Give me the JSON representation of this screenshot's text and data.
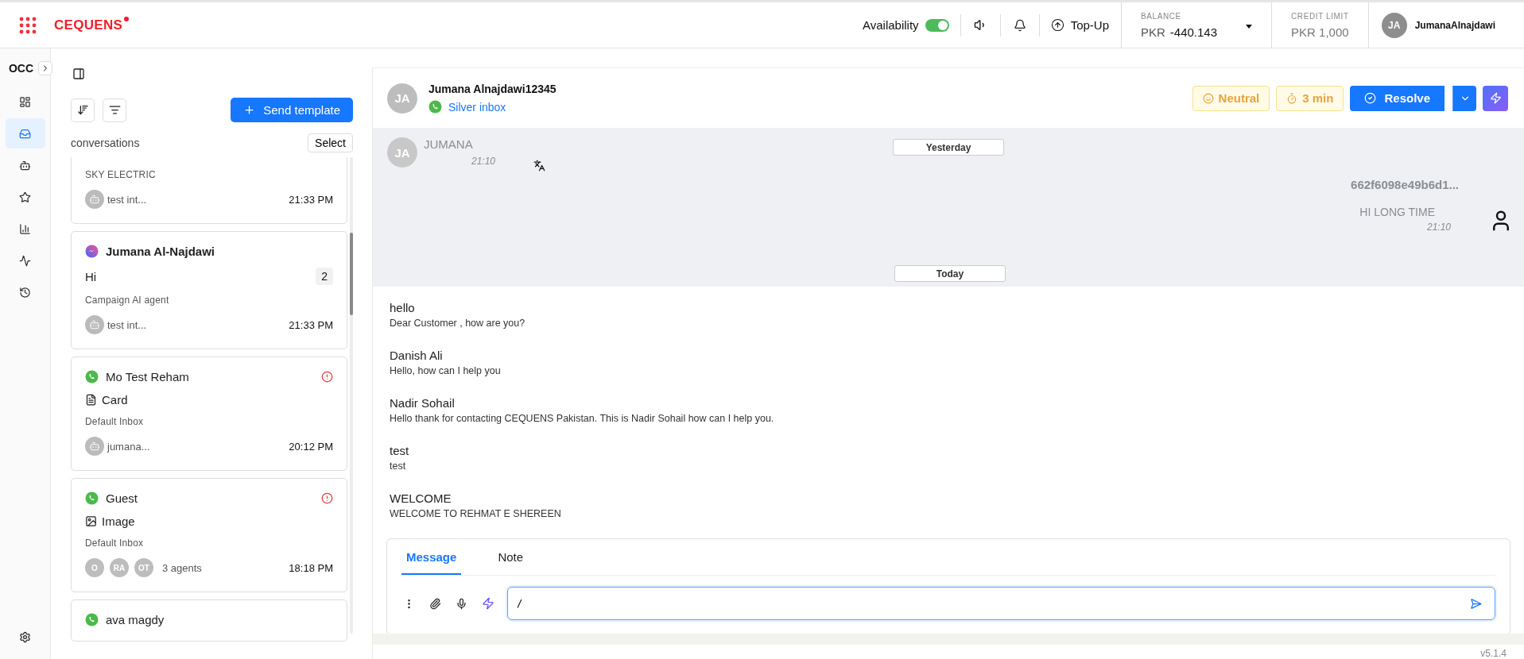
{
  "brand": {
    "name": "CEQUENS"
  },
  "topbar": {
    "availability": {
      "label": "Availability",
      "on": true
    },
    "topup": "Top-Up",
    "balance": {
      "label": "BALANCE",
      "currency": "PKR",
      "amount": "-440.143"
    },
    "credit_limit": {
      "label": "CREDIT LIMIT",
      "value": "PKR 1,000"
    },
    "user": {
      "initials": "JA",
      "name": "JumanaAlnajdawi"
    }
  },
  "nav": {
    "title": "OCC",
    "items": [
      {
        "selected": false
      },
      {
        "selected": true
      },
      {
        "selected": false
      },
      {
        "selected": false
      },
      {
        "selected": false
      },
      {
        "selected": false
      },
      {
        "selected": false
      }
    ]
  },
  "conversations": {
    "send_template": "Send template",
    "heading": "conversations",
    "select": "Select",
    "items": [
      {
        "inbox": "SKY ELECTRIC",
        "agent": "test int...",
        "time": "21:33 PM",
        "alert": false
      },
      {
        "channel": {
          "kind": "messenger"
        },
        "name": "Jumana Al-Najdawi",
        "bold": true,
        "preview": {
          "text": "Hi"
        },
        "unread": "2",
        "inbox": "Campaign AI agent",
        "agent": "test int...",
        "time": "21:33 PM",
        "alert": false
      },
      {
        "channel": {
          "kind": "whatsapp"
        },
        "name": "Mo Test Reham",
        "preview": {
          "text": "Card",
          "kind": "card"
        },
        "inbox": "Default Inbox",
        "agent": "jumana...",
        "time": "20:12 PM",
        "alert": true
      },
      {
        "channel": {
          "kind": "whatsapp"
        },
        "name": "Guest",
        "preview": {
          "text": "Image",
          "kind": "image"
        },
        "inbox": "Default Inbox",
        "assignees": [
          "O",
          "RA",
          "OT"
        ],
        "agents_label": "3 agents",
        "time": "18:18 PM",
        "alert": true
      },
      {
        "channel": {
          "kind": "whatsapp"
        },
        "name": "ava magdy",
        "alert": false
      }
    ]
  },
  "chat": {
    "contact": {
      "initials": "JA",
      "name": "Jumana Alnajdawi12345",
      "inbox": "Silver inbox"
    },
    "sentiment": "Neutral",
    "timer": "3 min",
    "resolve": "Resolve",
    "history": {
      "divider": "Yesterday",
      "incoming": {
        "initials": "JA",
        "sender": "JUMANA",
        "time": "21:10"
      },
      "outgoing": {
        "sender": "662f6098e49b6d1...",
        "text": "HI LONG TIME",
        "time": "21:10"
      }
    },
    "today": "Today",
    "messages": [
      {
        "title": "hello",
        "body": "Dear Customer , how are you?"
      },
      {
        "title": "Danish Ali",
        "body": "Hello, how can I help you"
      },
      {
        "title": "Nadir Sohail",
        "body": "Hello thank for contacting CEQUENS Pakistan. This is Nadir Sohail how can I help you."
      },
      {
        "title": "test",
        "body": "test"
      },
      {
        "title": "WELCOME",
        "body": "WELCOME TO REHMAT E SHEREEN"
      }
    ],
    "composer": {
      "tabs": [
        {
          "label": "Message",
          "selected": true
        },
        {
          "label": "Note",
          "selected": false
        }
      ],
      "value": "/"
    }
  },
  "version": "v5.1.4"
}
